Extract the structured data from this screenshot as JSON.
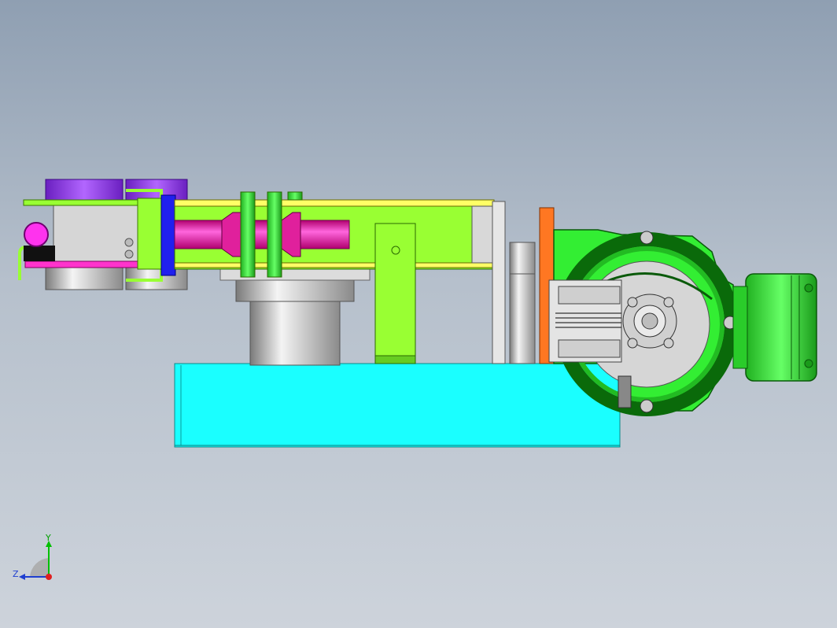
{
  "viewport": {
    "background": [
      "#8f9fb2",
      "#cdd3db"
    ]
  },
  "colors": {
    "base_plate": "#1affff",
    "frame_yellow": "#99ff33",
    "magenta_part": "#ff33cc",
    "purple_part": "#9933ff",
    "gear_green": "#33ff33",
    "orange_plate": "#ff7722",
    "grey_metal": "#c8c8c8"
  },
  "triad": {
    "y_label": "Y",
    "z_label": "Z",
    "y_color": "#00c000",
    "z_color": "#1f3fd0",
    "origin_color": "#e02020"
  }
}
